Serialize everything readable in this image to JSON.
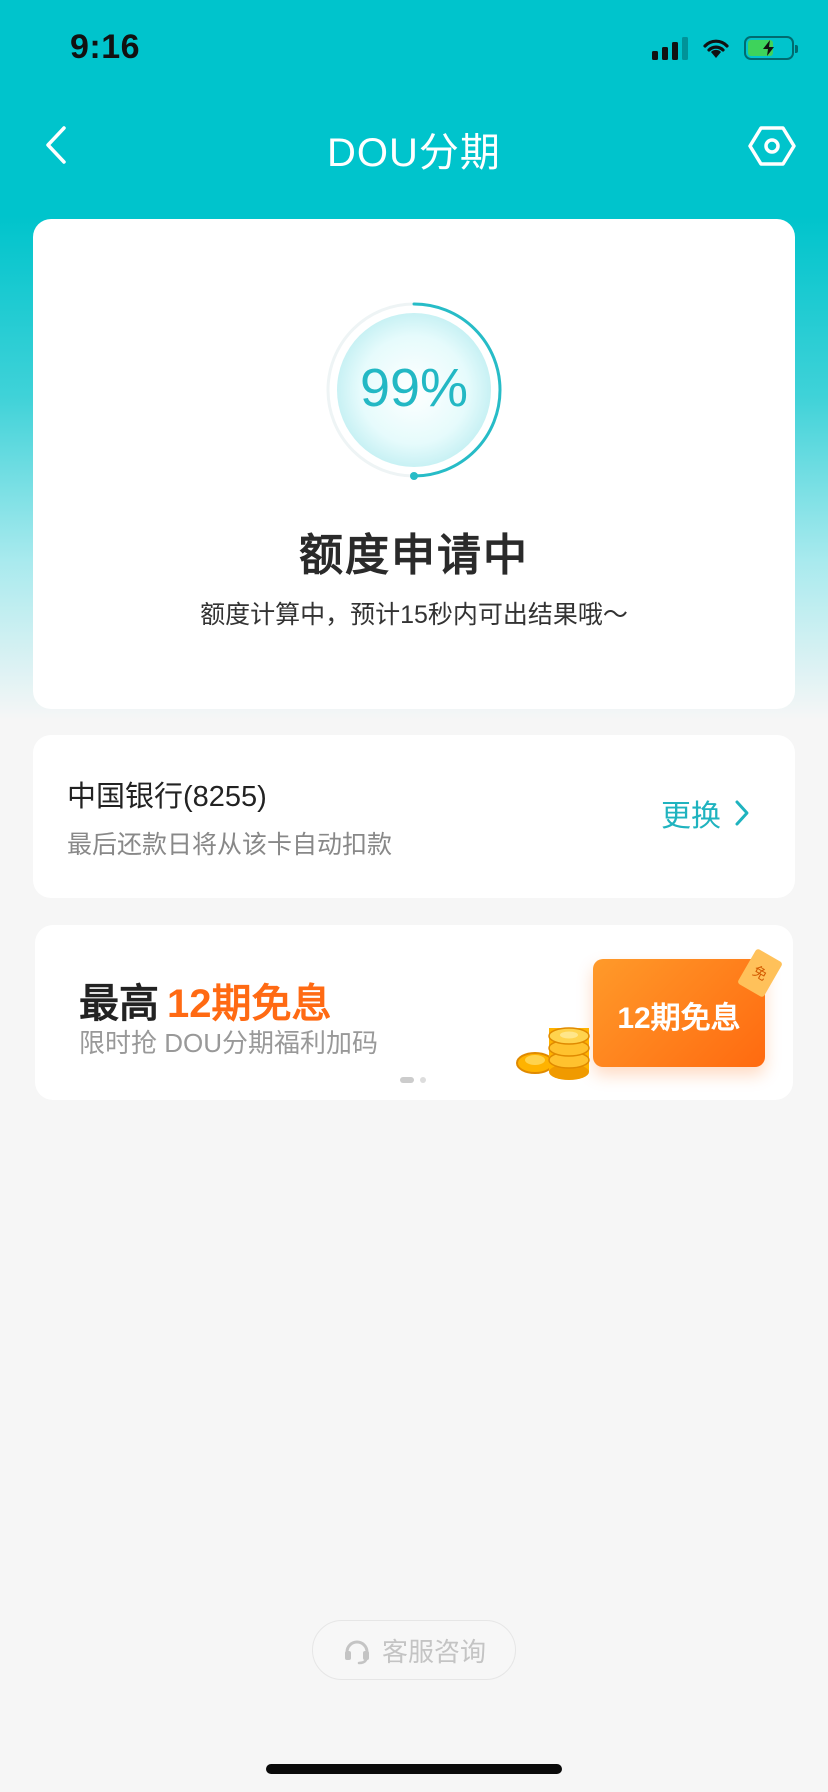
{
  "status_bar": {
    "time": "9:16"
  },
  "nav": {
    "title": "DOU分期"
  },
  "progress": {
    "percent": 99,
    "percent_label": "99%",
    "title": "额度申请中",
    "subtitle": "额度计算中，预计15秒内可出结果哦～"
  },
  "bank": {
    "name": "中国银行(8255)",
    "note": "最后还款日将从该卡自动扣款",
    "change_label": "更换"
  },
  "promo": {
    "title_prefix": "最高",
    "title_highlight": "12期免息",
    "subtitle": "限时抢 DOU分期福利加码",
    "coupon_text": "12期免息",
    "coupon_tag": "免",
    "carousel_index": 1,
    "carousel_count": 2
  },
  "service": {
    "label": "客服咨询"
  },
  "colors": {
    "brand": "#00c4cc",
    "accent_orange": "#ff6a13",
    "link": "#1fb3bf"
  }
}
